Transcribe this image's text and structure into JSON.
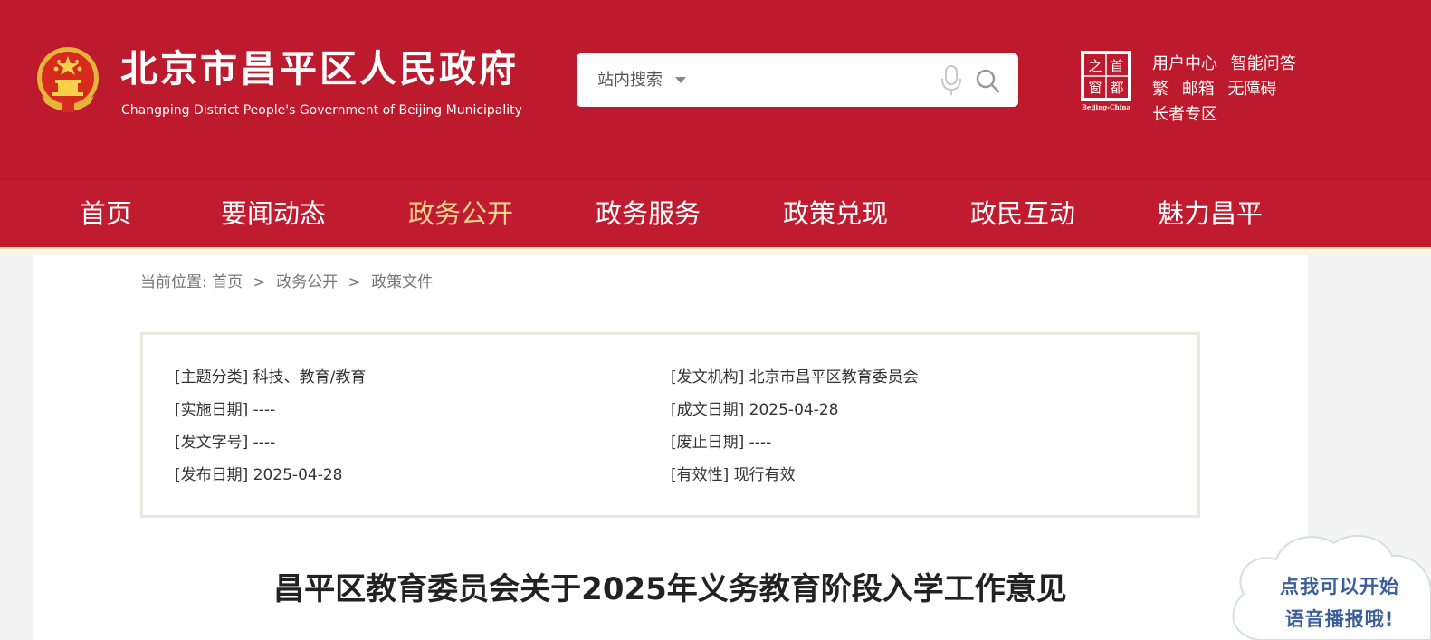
{
  "header": {
    "title": "北京市昌平区人民政府",
    "subtitle": "Changping District People's Government of Beijing Municipality",
    "search": {
      "scope": "站内搜索",
      "placeholder": ""
    },
    "capital_logo": {
      "chars": [
        "首",
        "都",
        "之",
        "窗"
      ],
      "caption": "Beijing-China"
    },
    "links": [
      [
        "用户中心",
        "智能问答"
      ],
      [
        "繁",
        "邮箱",
        "无障碍"
      ],
      [
        "长者专区"
      ]
    ]
  },
  "nav": {
    "items": [
      "首页",
      "要闻动态",
      "政务公开",
      "政务服务",
      "政策兑现",
      "政民互动",
      "魅力昌平"
    ],
    "active_index": 2
  },
  "breadcrumb": {
    "prefix": "当前位置:",
    "items": [
      "首页",
      "政务公开",
      "政策文件"
    ],
    "separator": ">"
  },
  "meta": {
    "topic": "[主题分类] 科技、教育/教育",
    "issuer": "[发文机构] 北京市昌平区教育委员会",
    "effective_date": "[实施日期] ----",
    "written_date": "[成文日期] 2025-04-28",
    "doc_number": "[发文字号] ----",
    "repeal_date": "[废止日期] ----",
    "publish_date": "[发布日期] 2025-04-28",
    "validity": "[有效性] 现行有效"
  },
  "article": {
    "title": "昌平区教育委员会关于2025年义务教育阶段入学工作意见"
  },
  "voice": {
    "line1": "点我可以开始",
    "line2": "语音播报哦!"
  },
  "colors": {
    "header_red": "#bd1a2d",
    "nav_active": "#f7d28f",
    "voice_text": "#3a5f9a"
  }
}
